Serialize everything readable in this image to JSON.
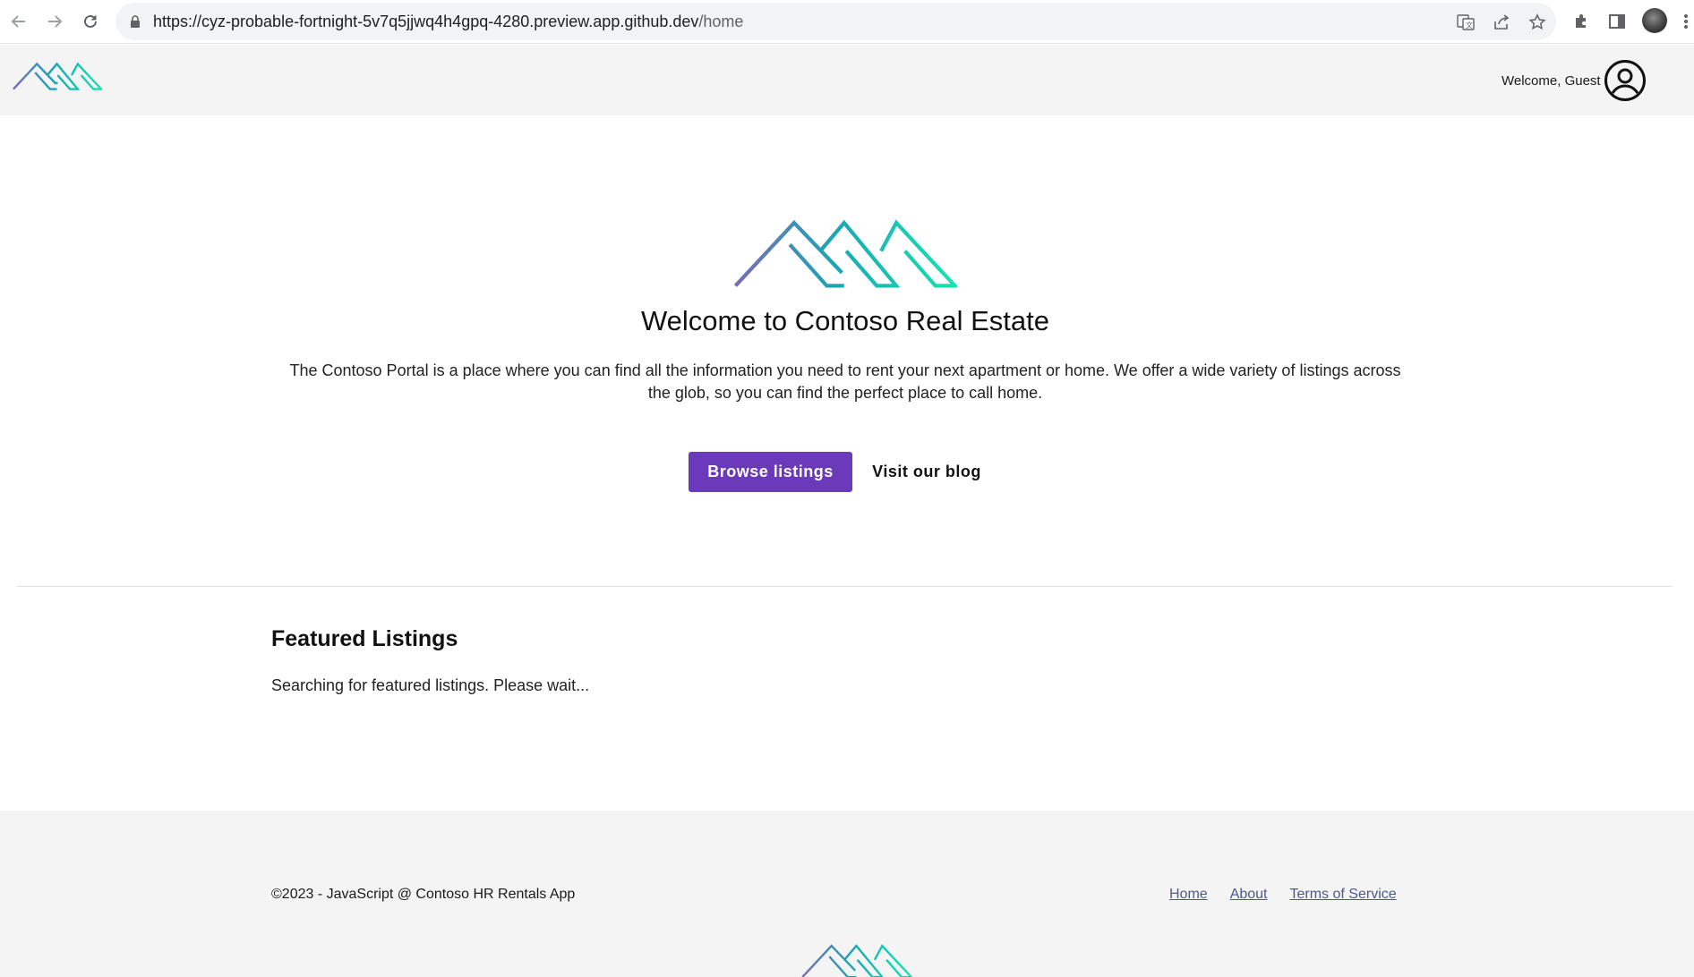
{
  "browser": {
    "url_host": "https://cyz-probable-fortnight-5v7q5jjwq4h4gpq-4280.preview.app.github.dev",
    "url_path": "/home"
  },
  "header": {
    "welcome_text": "Welcome, Guest"
  },
  "hero": {
    "title": "Welcome to Contoso Real Estate",
    "description": "The Contoso Portal is a place where you can find all the information you need to rent your next apartment or home. We offer a wide variety of listings across the glob, so you can find the perfect place to call home.",
    "primary_button": "Browse listings",
    "secondary_button": "Visit our blog"
  },
  "featured": {
    "title": "Featured Listings",
    "status": "Searching for featured listings. Please wait..."
  },
  "footer": {
    "copyright": "©2023 - JavaScript @ Contoso HR Rentals App",
    "links": [
      "Home",
      "About",
      "Terms of Service"
    ]
  },
  "colors": {
    "primary_button": "#6a3aba",
    "logo_start": "#7a6bb5",
    "logo_end": "#19e3b1",
    "footer_link": "#4c5a8a"
  }
}
